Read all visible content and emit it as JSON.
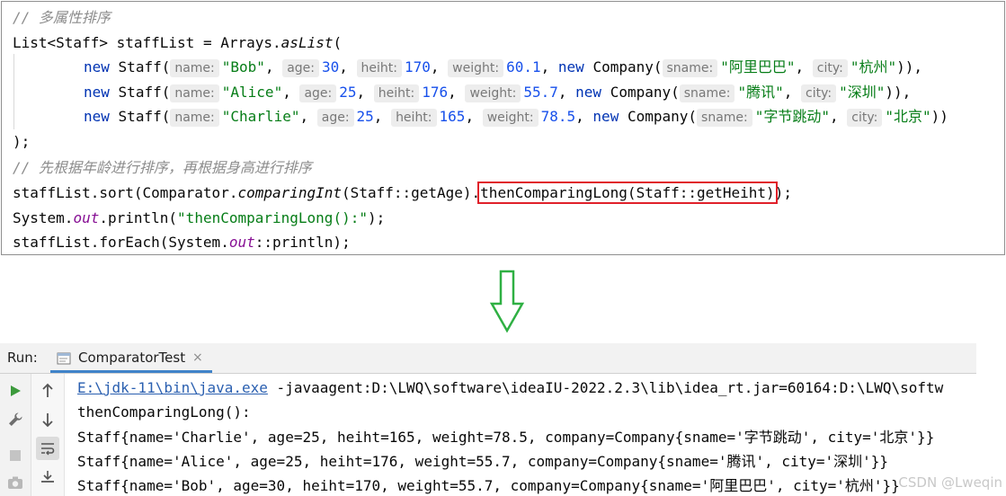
{
  "editor": {
    "comment1": "// 多属性排序",
    "line_list": {
      "type": "List<Staff>",
      "var": "staffList",
      "eq": "=",
      "cls": "Arrays.",
      "method": "asList",
      "paren": "("
    },
    "staff_rows": [
      {
        "kw_new": "new",
        "cls": "Staff(",
        "h_name": "name:",
        "name": "\"Bob\"",
        "h_age": "age:",
        "age": "30",
        "h_heiht": "heiht:",
        "heiht": "170",
        "h_weight": "weight:",
        "weight": "60.1",
        "kw_new2": "new",
        "cls2": "Company(",
        "h_sname": "sname:",
        "sname": "\"阿里巴巴\"",
        "h_city": "city:",
        "city": "\"杭州\"",
        "tail": ")),"
      },
      {
        "kw_new": "new",
        "cls": "Staff(",
        "h_name": "name:",
        "name": "\"Alice\"",
        "h_age": "age:",
        "age": "25",
        "h_heiht": "heiht:",
        "heiht": "176",
        "h_weight": "weight:",
        "weight": "55.7",
        "kw_new2": "new",
        "cls2": "Company(",
        "h_sname": "sname:",
        "sname": "\"腾讯\"",
        "h_city": "city:",
        "city": "\"深圳\"",
        "tail": ")),"
      },
      {
        "kw_new": "new",
        "cls": "Staff(",
        "h_name": "name:",
        "name": "\"Charlie\"",
        "h_age": "age:",
        "age": "25",
        "h_heiht": "heiht:",
        "heiht": "165",
        "h_weight": "weight:",
        "weight": "78.5",
        "kw_new2": "new",
        "cls2": "Company(",
        "h_sname": "sname:",
        "sname": "\"字节跳动\"",
        "h_city": "city:",
        "city": "\"北京\"",
        "tail": "))"
      }
    ],
    "close_list": ");",
    "comment2": "// 先根据年龄进行排序，再根据身高进行排序",
    "sort_line": {
      "pre": "staffList.sort(Comparator.",
      "method": "comparingInt",
      "mid": "(Staff::getAge).",
      "highlight": "thenComparingLong(Staff::getHeiht)",
      "post": ");"
    },
    "print_line": {
      "pre": "System.",
      "field": "out",
      "mid": ".println(",
      "str": "\"thenComparingLong():\"",
      "post": ");"
    },
    "foreach_line": {
      "pre": "staffList.forEach(System.",
      "field": "out",
      "post": "::println);"
    }
  },
  "run_panel": {
    "run_label": "Run:",
    "tab_label": "ComparatorTest",
    "tab_close": "×",
    "console": {
      "cmd_link": "E:\\jdk-11\\bin\\java.exe",
      "cmd_rest": " -javaagent:D:\\LWQ\\software\\ideaIU-2022.2.3\\lib\\idea_rt.jar=60164:D:\\LWQ\\softw",
      "lines": [
        "thenComparingLong():",
        "Staff{name='Charlie', age=25, heiht=165, weight=78.5, company=Company{sname='字节跳动', city='北京'}}",
        "Staff{name='Alice', age=25, heiht=176, weight=55.7, company=Company{sname='腾讯', city='深圳'}}",
        "Staff{name='Bob', age=30, heiht=170, weight=55.7, company=Company{sname='阿里巴巴', city='杭州'}}"
      ]
    }
  },
  "watermark": "CSDN @Lweqin",
  "colors": {
    "highlight_box": "#e0202a",
    "arrow": "#2fb043",
    "tab_accent": "#4083c9",
    "run_green": "#3c9a3c"
  },
  "icons": [
    "run-icon",
    "wrench-icon",
    "stop-icon",
    "camera-icon",
    "up-arrow-icon",
    "down-arrow-icon",
    "soft-wrap-icon",
    "scroll-to-end-icon",
    "console-tab-icon",
    "down-arrow-outline-icon"
  ]
}
